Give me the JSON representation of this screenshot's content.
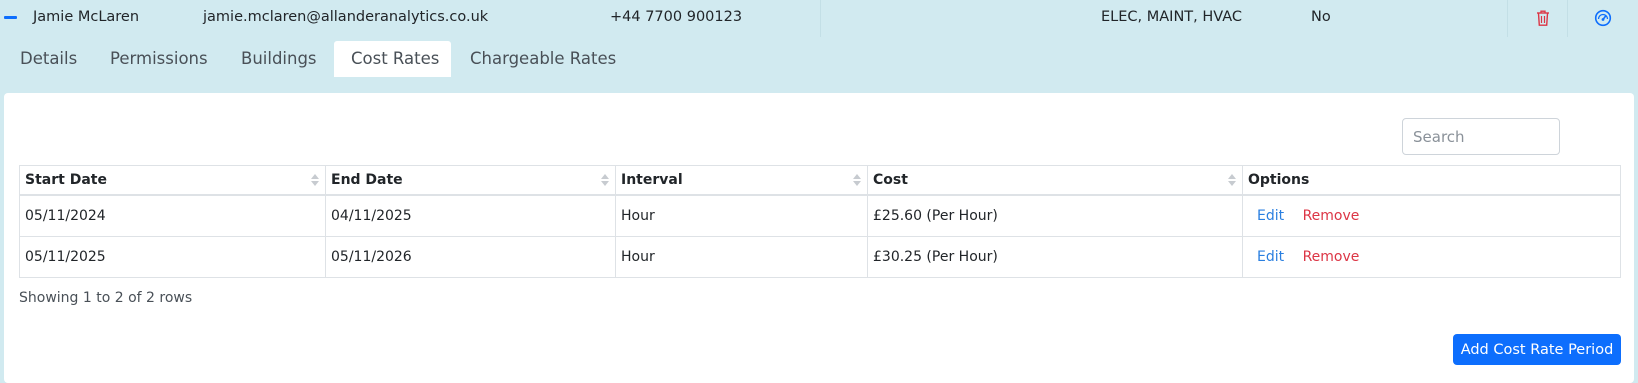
{
  "user": {
    "name": "Jamie McLaren",
    "email": "jamie.mclaren@allanderanalytics.co.uk",
    "phone": "+44 7700 900123",
    "trades": "ELEC, MAINT, HVAC",
    "flag": "No",
    "icons": [
      "collapse-icon",
      "trash-icon",
      "gauge-icon"
    ],
    "colors": {
      "trash": "#dc3545",
      "gauge": "#0d6efd"
    }
  },
  "tabs": [
    {
      "label": "Details"
    },
    {
      "label": "Permissions"
    },
    {
      "label": "Buildings"
    },
    {
      "label": "Cost Rates",
      "active": true
    },
    {
      "label": "Chargeable Rates"
    }
  ],
  "search": {
    "placeholder": "Search",
    "value": ""
  },
  "table": {
    "columns": [
      "Start Date",
      "End Date",
      "Interval",
      "Cost",
      "Options"
    ],
    "rows": [
      {
        "start": "05/11/2024",
        "end": "04/11/2025",
        "interval": "Hour",
        "cost": "£25.60 (Per Hour)",
        "edit": "Edit",
        "remove": "Remove"
      },
      {
        "start": "05/11/2025",
        "end": "05/11/2026",
        "interval": "Hour",
        "cost": "£30.25 (Per Hour)",
        "edit": "Edit",
        "remove": "Remove"
      }
    ]
  },
  "footer": {
    "showing": "Showing 1 to 2 of 2 rows",
    "add_button": "Add Cost Rate Period"
  },
  "colors": {
    "background": "#d1eaf0",
    "primary": "#0d6efd",
    "danger": "#dc3545",
    "link": "#2a7fe0"
  }
}
